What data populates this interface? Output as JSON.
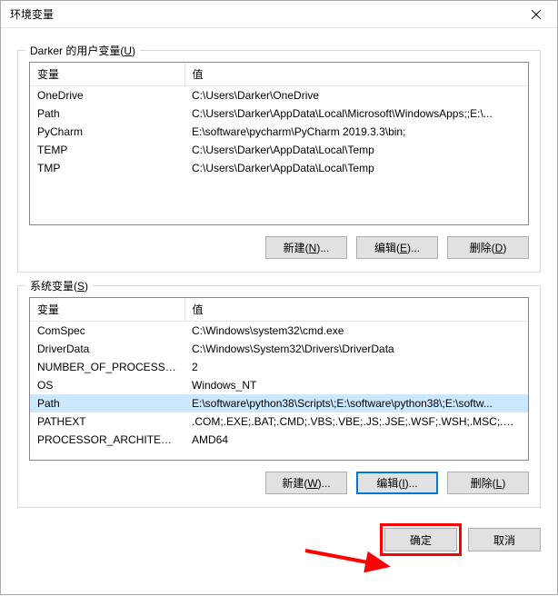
{
  "title": "环境变量",
  "user_section": {
    "label_prefix": "Darker 的用户变量(",
    "hotkey": "U",
    "label_suffix": ")",
    "columns": {
      "name": "变量",
      "value": "值"
    },
    "rows": [
      {
        "name": "OneDrive",
        "value": "C:\\Users\\Darker\\OneDrive"
      },
      {
        "name": "Path",
        "value": "C:\\Users\\Darker\\AppData\\Local\\Microsoft\\WindowsApps;;E:\\..."
      },
      {
        "name": "PyCharm",
        "value": "E:\\software\\pycharm\\PyCharm 2019.3.3\\bin;"
      },
      {
        "name": "TEMP",
        "value": "C:\\Users\\Darker\\AppData\\Local\\Temp"
      },
      {
        "name": "TMP",
        "value": "C:\\Users\\Darker\\AppData\\Local\\Temp"
      }
    ],
    "buttons": {
      "new_prefix": "新建(",
      "new_hot": "N",
      "new_suffix": ")...",
      "edit_prefix": "编辑(",
      "edit_hot": "E",
      "edit_suffix": ")...",
      "del_prefix": "删除(",
      "del_hot": "D",
      "del_suffix": ")"
    }
  },
  "system_section": {
    "label_prefix": "系统变量(",
    "hotkey": "S",
    "label_suffix": ")",
    "columns": {
      "name": "变量",
      "value": "值"
    },
    "rows": [
      {
        "name": "ComSpec",
        "value": "C:\\Windows\\system32\\cmd.exe"
      },
      {
        "name": "DriverData",
        "value": "C:\\Windows\\System32\\Drivers\\DriverData"
      },
      {
        "name": "NUMBER_OF_PROCESSORS",
        "value": "2"
      },
      {
        "name": "OS",
        "value": "Windows_NT"
      },
      {
        "name": "Path",
        "value": "E:\\software\\python38\\Scripts\\;E:\\software\\python38\\;E:\\softw...",
        "selected": true
      },
      {
        "name": "PATHEXT",
        "value": ".COM;.EXE;.BAT;.CMD;.VBS;.VBE;.JS;.JSE;.WSF;.WSH;.MSC;.PY;.P..."
      },
      {
        "name": "PROCESSOR_ARCHITECT...",
        "value": "AMD64"
      }
    ],
    "buttons": {
      "new_prefix": "新建(",
      "new_hot": "W",
      "new_suffix": ")...",
      "edit_prefix": "编辑(",
      "edit_hot": "I",
      "edit_suffix": ")...",
      "del_prefix": "删除(",
      "del_hot": "L",
      "del_suffix": ")"
    }
  },
  "bottom": {
    "ok": "确定",
    "cancel": "取消"
  }
}
